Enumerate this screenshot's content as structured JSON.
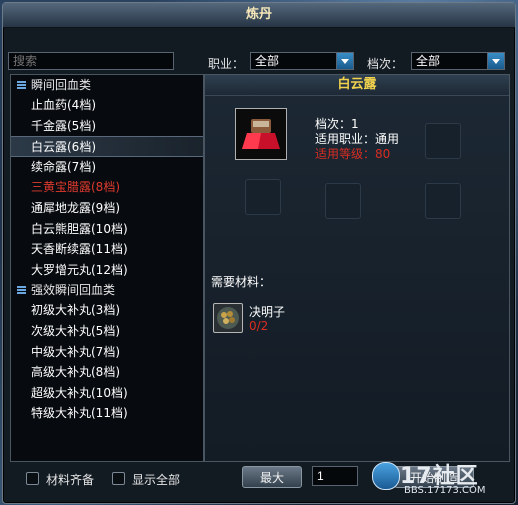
{
  "window": {
    "title": "炼丹"
  },
  "filters": {
    "search_placeholder": "搜索",
    "job_label": "职业：",
    "job_value": "全部",
    "grade_label": "档次：",
    "grade_value": "全部"
  },
  "categories": [
    {
      "label": "瞬间回血类",
      "items": [
        {
          "label": "止血药(4档)",
          "state": "normal"
        },
        {
          "label": "千金露(5档)",
          "state": "normal"
        },
        {
          "label": "白云露(6档)",
          "state": "selected"
        },
        {
          "label": "续命露(7档)",
          "state": "normal"
        },
        {
          "label": "三黄宝腊露(8档)",
          "state": "unavailable"
        },
        {
          "label": "通犀地龙露(9档)",
          "state": "normal"
        },
        {
          "label": "白云熊胆露(10档)",
          "state": "normal"
        },
        {
          "label": "天香断续露(11档)",
          "state": "normal"
        },
        {
          "label": "大罗增元丸(12档)",
          "state": "normal"
        }
      ]
    },
    {
      "label": "强效瞬间回血类",
      "items": [
        {
          "label": "初级大补丸(3档)",
          "state": "normal"
        },
        {
          "label": "次级大补丸(5档)",
          "state": "normal"
        },
        {
          "label": "中级大补丸(7档)",
          "state": "normal"
        },
        {
          "label": "高级大补丸(8档)",
          "state": "normal"
        },
        {
          "label": "超级大补丸(10档)",
          "state": "normal"
        },
        {
          "label": "特级大补丸(11档)",
          "state": "normal"
        }
      ]
    }
  ],
  "left_bottom": {
    "materials_ready_label": "材料齐备",
    "show_all_label": "显示全部"
  },
  "detail": {
    "item_name": "白云露",
    "grade_line": "档次：1",
    "job_line": "适用职业：通用",
    "level_line": "适用等级：80",
    "need_label": "需要材料：",
    "material_name": "决明子",
    "material_count": "0/2"
  },
  "right_bottom": {
    "max_button": "最大",
    "quantity": "1",
    "make_button": "开始制造"
  },
  "watermark": {
    "text": "17社区",
    "url": "BBS.17173.COM"
  },
  "colors": {
    "selected_name": "#f2d34e",
    "unavailable": "#e03a2e",
    "insufficient": "#d82d22"
  }
}
